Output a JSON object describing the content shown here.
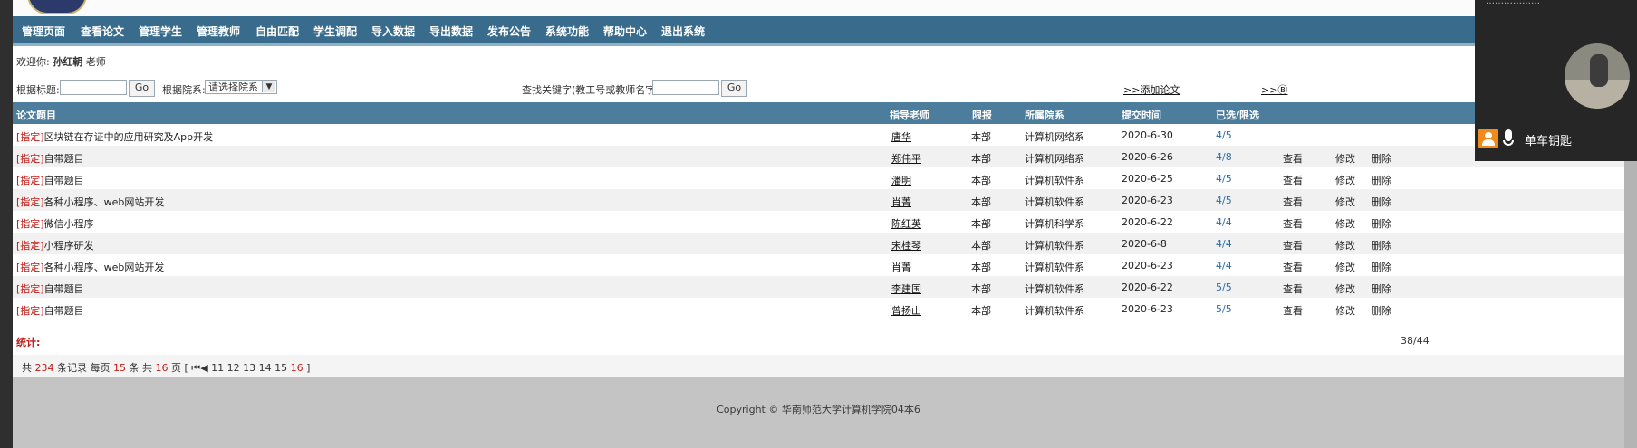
{
  "nav": [
    "管理页面",
    "查看论文",
    "管理学生",
    "管理教师",
    "自由匹配",
    "学生调配",
    "导入数据",
    "导出数据",
    "发布公告",
    "系统功能",
    "帮助中心",
    "退出系统"
  ],
  "welcome": {
    "prefix": "欢迎你:",
    "name": "孙红朝",
    "suffix": "老师"
  },
  "filters": {
    "title_label": "根据标题:",
    "go": "Go",
    "dept_label": "根据院系:",
    "dept_select": "请选择院系",
    "keyword_label": "查找关键字(教工号或教师名字):",
    "add_link": ">>添加论文",
    "other_link": ">>Ⓑ"
  },
  "table": {
    "headers": [
      "论文题目",
      "指导老师",
      "限报",
      "所属院系",
      "提交时间",
      "已选/限选"
    ],
    "rows": [
      {
        "tag": "[指定]",
        "title": "区块链在存证中的应用研究及App开发",
        "teacher": "唐华",
        "limit": "本部",
        "dept": "计算机网络系",
        "date": "2020-6-30",
        "ratio": "4/5"
      },
      {
        "tag": "[指定]",
        "title": "自带题目",
        "teacher": "郑伟平",
        "limit": "本部",
        "dept": "计算机网络系",
        "date": "2020-6-26",
        "ratio": "4/8"
      },
      {
        "tag": "[指定]",
        "title": "自带题目",
        "teacher": "潘明",
        "limit": "本部",
        "dept": "计算机软件系",
        "date": "2020-6-25",
        "ratio": "4/5"
      },
      {
        "tag": "[指定]",
        "title": "各种小程序、web网站开发",
        "teacher": "肖菁",
        "limit": "本部",
        "dept": "计算机软件系",
        "date": "2020-6-23",
        "ratio": "4/5"
      },
      {
        "tag": "[指定]",
        "title": "微信小程序",
        "teacher": "陈红英",
        "limit": "本部",
        "dept": "计算机科学系",
        "date": "2020-6-22",
        "ratio": "4/4"
      },
      {
        "tag": "[指定]",
        "title": "小程序研发",
        "teacher": "宋桂琴",
        "limit": "本部",
        "dept": "计算机软件系",
        "date": "2020-6-8",
        "ratio": "4/4"
      },
      {
        "tag": "[指定]",
        "title": "各种小程序、web网站开发",
        "teacher": "肖菁",
        "limit": "本部",
        "dept": "计算机软件系",
        "date": "2020-6-23",
        "ratio": "4/4"
      },
      {
        "tag": "[指定]",
        "title": "自带题目",
        "teacher": "李建国",
        "limit": "本部",
        "dept": "计算机软件系",
        "date": "2020-6-22",
        "ratio": "5/5"
      },
      {
        "tag": "[指定]",
        "title": "自带题目",
        "teacher": "曾扬山",
        "limit": "本部",
        "dept": "计算机软件系",
        "date": "2020-6-23",
        "ratio": "5/5"
      }
    ],
    "actions": [
      "查看",
      "修改",
      "删除"
    ]
  },
  "stats": {
    "label": "统计:",
    "total": "38/44"
  },
  "pager": {
    "p1": "共",
    "records": "234",
    "p2": "条记录 每页",
    "per_page": "15",
    "p3": "条 共",
    "pages": "16",
    "p4": "页 [",
    "first": "⏮◀",
    "page_links": [
      "11",
      "12",
      "13",
      "14",
      "15"
    ],
    "current": "16",
    "p5": "]"
  },
  "copyright": "Copyright © 华南师范大学计算机学院04本6",
  "overlay": {
    "top_text": "………………",
    "name": "单车钥匙"
  }
}
